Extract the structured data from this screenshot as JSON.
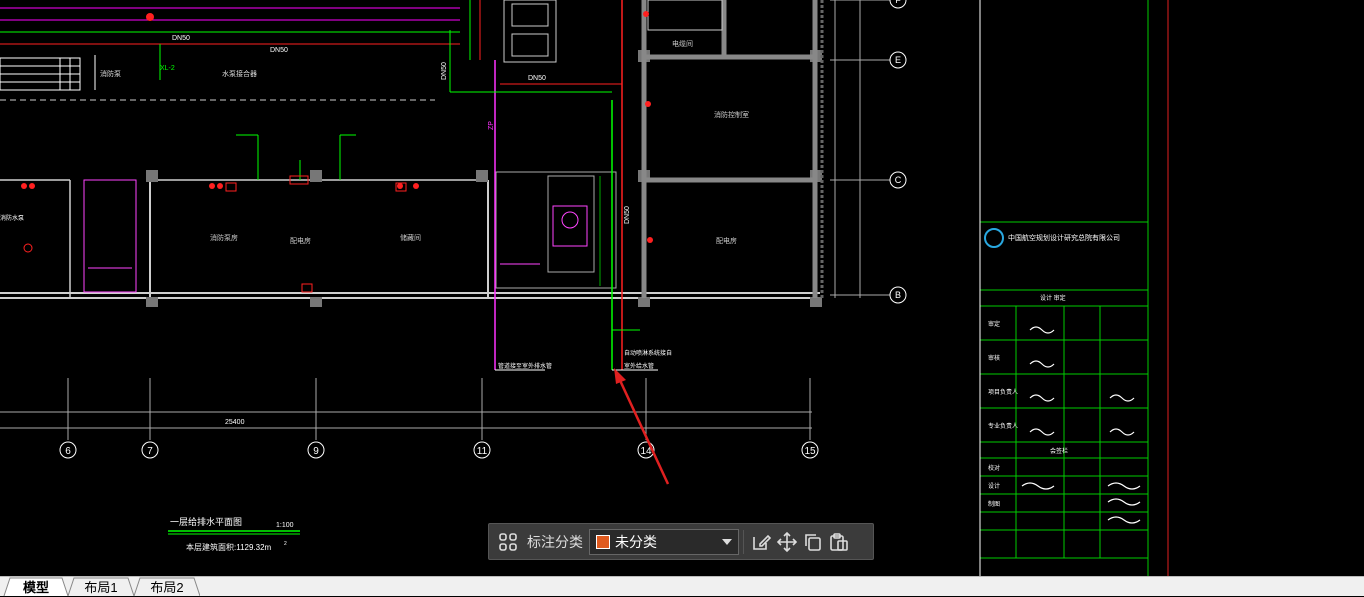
{
  "drawing": {
    "axis_labels_bottom": [
      "6",
      "7",
      "9",
      "11",
      "14",
      "15"
    ],
    "axis_labels_right": [
      "F",
      "E",
      "C",
      "B"
    ],
    "total_dim": "25400",
    "plan_title": "一层给排水平面图",
    "plan_scale": "1:100",
    "plan_area": "本层建筑面积:1129.32m",
    "area_sup": "2",
    "dn_labels": [
      "DN50",
      "DN50",
      "DN50",
      "DN50",
      "DN50"
    ],
    "pipe_label_zp": "ZP",
    "xl_label": "XL-2",
    "annot_1": "管道接至室外排水管",
    "annot_2": "自动喷淋系统接自",
    "annot_3": "室外给水管",
    "room_left": "消防泵房",
    "room_mid": "配电房",
    "title_block": {
      "company": "中国航空规划设计研究总院有限公司",
      "rows": [
        "审定",
        "审核",
        "项目负责人",
        "专业负责人",
        "校对",
        "设计",
        "制图"
      ],
      "heading": "会签栏"
    }
  },
  "toolbar": {
    "label": "标注分类",
    "selected": "未分类",
    "swatch_color": "#e05a1e"
  },
  "tabs": [
    {
      "label": "模型"
    },
    {
      "label": "布局1"
    },
    {
      "label": "布局2"
    }
  ]
}
